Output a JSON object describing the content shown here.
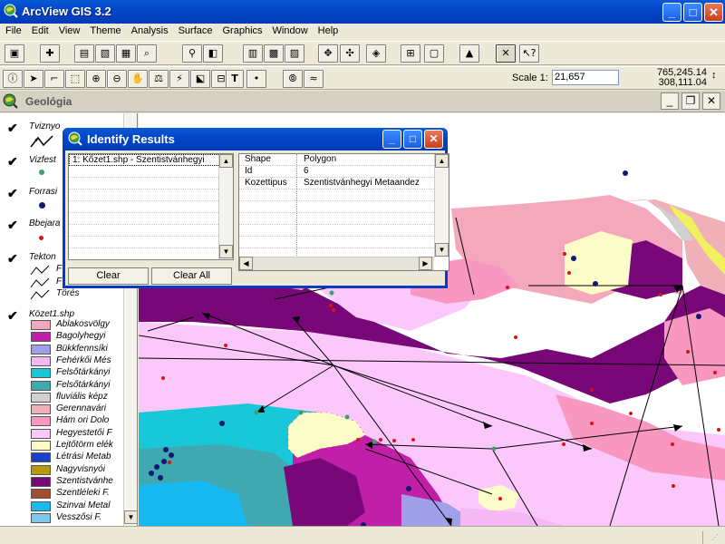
{
  "app": {
    "title": "ArcView GIS 3.2"
  },
  "menu": [
    "File",
    "Edit",
    "View",
    "Theme",
    "Analysis",
    "Surface",
    "Graphics",
    "Window",
    "Help"
  ],
  "toolbar1": [
    "save-icon",
    "add-theme-icon",
    "theme-properties-icon",
    "edit-legend-icon",
    "open-table-icon",
    "find-icon",
    "locate-address-icon",
    "query-builder-icon",
    "zoom-full-icon",
    "zoom-active-themes-icon",
    "zoom-selected-icon",
    "zoom-previous-icon",
    "select-features-icon",
    "clear-selection-icon",
    "create-chart-icon",
    "help-icon"
  ],
  "toolbar2": [
    "identify-tool",
    "pointer-tool",
    "vertex-edit-tool",
    "select-feature-tool",
    "zoom-in-tool",
    "zoom-out-tool",
    "pan-tool",
    "measure-tool",
    "hotlink-tool",
    "area-select-tool",
    "label-tool",
    "text-tool",
    "draw-point-tool",
    "snap-tool",
    "spline-tool"
  ],
  "scale": {
    "label": "Scale 1:",
    "value": "21,657"
  },
  "coords": {
    "x": "765,245.14",
    "y": "308,111.04"
  },
  "view": {
    "title": "Geológia"
  },
  "toc": {
    "themes": [
      {
        "name": "Tviznyo",
        "checked": true
      },
      {
        "name": "Vizfest",
        "checked": true
      },
      {
        "name": "Forrasi",
        "checked": true
      },
      {
        "name": "Bbejara",
        "checked": true
      },
      {
        "name": "Tekton",
        "checked": true
      },
      {
        "name": "Közet1.shp",
        "checked": true
      }
    ],
    "tekton_legend": [
      "F",
      "F",
      "Törés"
    ],
    "legend": [
      {
        "label": "Ablakosvölgy",
        "color": "#f4a8bc"
      },
      {
        "label": "Bagolyhegyi",
        "color": "#c020a8"
      },
      {
        "label": "Bükkfennsíki",
        "color": "#a0a0e8"
      },
      {
        "label": "Fehérkői Més",
        "color": "#f4b8f4"
      },
      {
        "label": "Felsőtárkányi",
        "color": "#18c8d8"
      },
      {
        "label": "Felsőtárkányi",
        "color": "#40a8b0"
      },
      {
        "label": "fluviális képz",
        "color": "#d0d0d0"
      },
      {
        "label": "Gerennavári",
        "color": "#f0b0b8"
      },
      {
        "label": "Hám ori Dolo",
        "color": "#f898c0"
      },
      {
        "label": "Hegyestetői F",
        "color": "#fcc8fc"
      },
      {
        "label": "Lejtőtörm elék",
        "color": "#fcfcc8"
      },
      {
        "label": "Létrási Metab",
        "color": "#1840c8"
      },
      {
        "label": "Nagyvisnyói",
        "color": "#b89810"
      },
      {
        "label": "Szentistvánhe",
        "color": "#780878"
      },
      {
        "label": "Szentléleki F.",
        "color": "#a05030"
      },
      {
        "label": "Szinvai Metal",
        "color": "#18b8f0"
      },
      {
        "label": "Vesszősi F.",
        "color": "#80c8e8"
      }
    ]
  },
  "identify": {
    "title": "Identify Results",
    "results": [
      "1:  Kőzet1.shp - Szentistvánhegyi"
    ],
    "attributes": [
      {
        "field": "Shape",
        "value": "Polygon"
      },
      {
        "field": "Id",
        "value": "6"
      },
      {
        "field": "Kozettipus",
        "value": "Szentistvánhegyi Metaandez"
      }
    ],
    "clear_label": "Clear",
    "clear_all_label": "Clear All"
  }
}
